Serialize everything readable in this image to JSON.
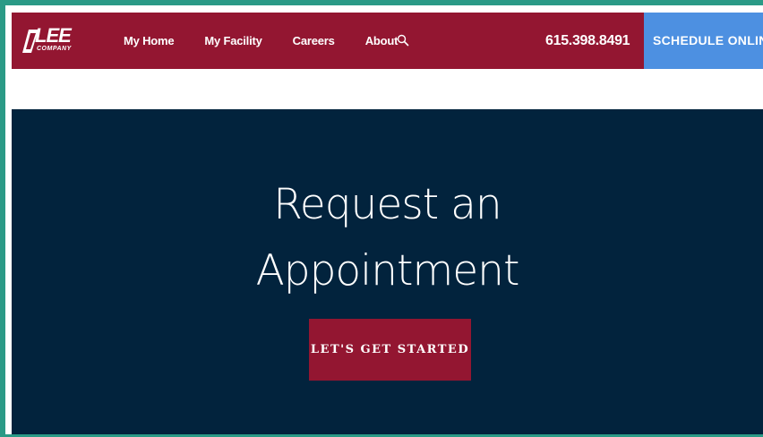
{
  "header": {
    "logo": {
      "name": "LEE",
      "sub": "COMPANY"
    },
    "nav": [
      {
        "label": "My Home"
      },
      {
        "label": "My Facility"
      },
      {
        "label": "Careers"
      },
      {
        "label": "About"
      }
    ],
    "search_icon": "search-icon",
    "phone": "615.398.8491",
    "schedule_label": "SCHEDULE ONLINE"
  },
  "hero": {
    "title_line1": "Request an",
    "title_line2": "Appointment",
    "cta_label": "LET'S GET STARTED"
  },
  "colors": {
    "brand_red": "#931631",
    "accent_blue": "#4d90e1",
    "hero_navy": "#02233d",
    "frame_teal": "#2a9a86"
  }
}
